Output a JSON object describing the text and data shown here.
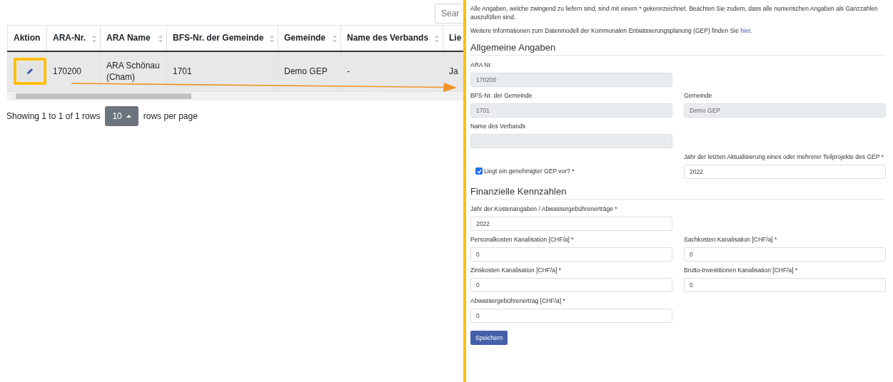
{
  "table": {
    "search": {
      "placeholder": "Sear"
    },
    "columns": [
      {
        "label": "Aktion",
        "sortable": false
      },
      {
        "label": "ARA-Nr.",
        "sortable": true
      },
      {
        "label": "ARA Name",
        "sortable": true
      },
      {
        "label": "BFS-Nr. der Gemeinde",
        "sortable": true
      },
      {
        "label": "Gemeinde",
        "sortable": true
      },
      {
        "label": "Name des Verbands",
        "sortable": true
      },
      {
        "label": "Lie",
        "sortable": false
      }
    ],
    "rows": [
      {
        "selected": true,
        "cells": [
          "",
          "170200",
          "ARA Schönau (Cham)",
          "1701",
          "Demo GEP",
          "-",
          "Ja"
        ]
      }
    ],
    "pagination": {
      "summary": "Showing 1 to 1 of 1 rows",
      "page_size": "10",
      "suffix": "rows per page"
    }
  },
  "form": {
    "intro": "Alle Angaben, welche zwingend zu liefern sind, sind mit einem * gekennzeichnet. Beachten Sie zudem, dass alle numerischen Angaben als Ganzzahlen auszufüllen sind.",
    "info": {
      "text": "Weitere Informationen zum Datenmodell der Kommunalen Entwässerungsplanung (GEP) finden Sie ",
      "link": "hier",
      "end": "."
    },
    "sections": [
      {
        "title": "Allgemeine Angaben",
        "rows": [
          [
            {
              "kind": "input",
              "label": "ARA Nr.",
              "value": "170200",
              "disabled": true
            }
          ],
          [
            {
              "kind": "input",
              "label": "BFS-Nr. der Gemeinde",
              "value": "1701",
              "disabled": true
            },
            {
              "kind": "input",
              "label": "Gemeinde",
              "value": "Demo GEP",
              "disabled": true
            }
          ],
          [
            {
              "kind": "input",
              "label": "Name des Verbands",
              "disabled": true
            }
          ],
          [
            {
              "kind": "checkbox",
              "label": "Liegt ein genehmigter GEP vor? *",
              "checked": true
            },
            {
              "kind": "input",
              "label": "Jahr der letzten Aktualisierung eines oder mehrerer Teilprojekte des GEP *",
              "value": "2022",
              "disabled": false
            }
          ]
        ]
      },
      {
        "title": "Finanzielle Kennzahlen",
        "rows": [
          [
            {
              "kind": "input",
              "label": "Jahr der Kostenangaben / Abwassergebührenerträge *",
              "value": "2022",
              "disabled": false
            }
          ],
          [
            {
              "kind": "input",
              "label": "Personalkosten Kanalisation [CHF/a] *",
              "value": "0",
              "disabled": false
            },
            {
              "kind": "input",
              "label": "Sachkosten Kanalisation [CHF/a] *",
              "value": "0",
              "disabled": false
            }
          ],
          [
            {
              "kind": "input",
              "label": "Zinskosten Kanalisation [CHF/a] *",
              "value": "0",
              "disabled": false
            },
            {
              "kind": "input",
              "label": "Brutto-Investitionen Kanalisation [CHF/a] *",
              "value": "0",
              "disabled": false
            }
          ],
          [
            {
              "kind": "input",
              "label": "Abwassergebührenertrag [CHF/a] *",
              "value": "0",
              "disabled": false
            }
          ]
        ]
      }
    ],
    "button": "Speichern"
  }
}
